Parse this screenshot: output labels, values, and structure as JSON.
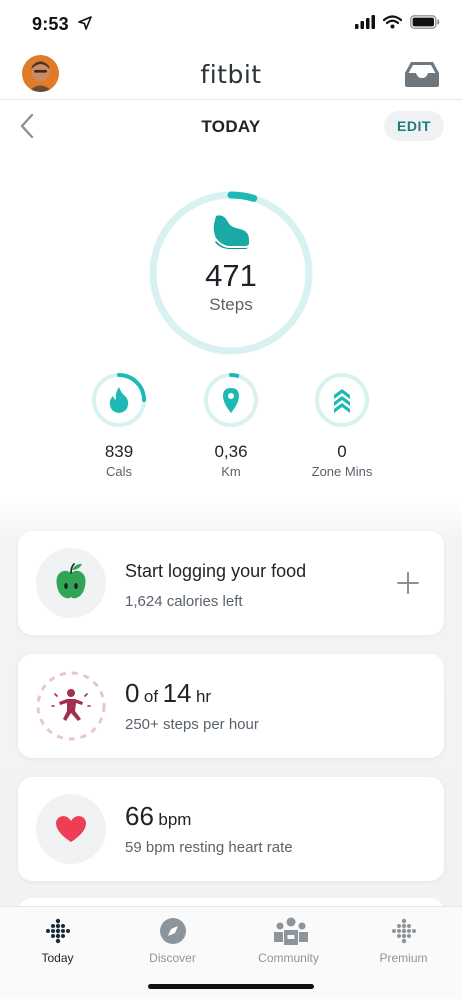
{
  "status_bar": {
    "time": "9:53"
  },
  "header": {
    "brand": "fitbit"
  },
  "sub_header": {
    "title": "TODAY",
    "edit_label": "EDIT"
  },
  "steps": {
    "value": "471",
    "label": "Steps",
    "progress": 0.047
  },
  "stats": [
    {
      "value": "839",
      "label": "Cals",
      "icon": "flame-icon",
      "progress": 0.25
    },
    {
      "value": "0,36",
      "label": "Km",
      "icon": "location-pin-icon",
      "progress": 0.04
    },
    {
      "value": "0",
      "label": "Zone Mins",
      "icon": "zone-chevrons-icon",
      "progress": 0
    }
  ],
  "cards": {
    "food": {
      "title": "Start logging your food",
      "subtitle": "1,624 calories left",
      "icon": "apple-icon"
    },
    "hourly": {
      "value": "0",
      "of": "of",
      "target": "14",
      "unit": "hr",
      "subtitle": "250+ steps per hour",
      "icon": "active-person-icon"
    },
    "heart": {
      "value": "66",
      "unit": "bpm",
      "subtitle": "59 bpm resting heart rate",
      "icon": "heart-icon"
    }
  },
  "tab_bar": {
    "tabs": [
      {
        "label": "Today",
        "icon": "fitbit-dots-icon",
        "active": true
      },
      {
        "label": "Discover",
        "icon": "compass-icon",
        "active": false
      },
      {
        "label": "Community",
        "icon": "community-icon",
        "active": false
      },
      {
        "label": "Premium",
        "icon": "premium-dots-icon",
        "active": false
      }
    ]
  },
  "colors": {
    "teal": "#1eb8b5",
    "teal_light": "#d8f1f1",
    "text": "#1f2329",
    "muted": "#5a636b",
    "edit_text": "#1c7a80",
    "apple": "#2fa555",
    "heart": "#ee3e55",
    "hourly": "#a32f4f"
  }
}
